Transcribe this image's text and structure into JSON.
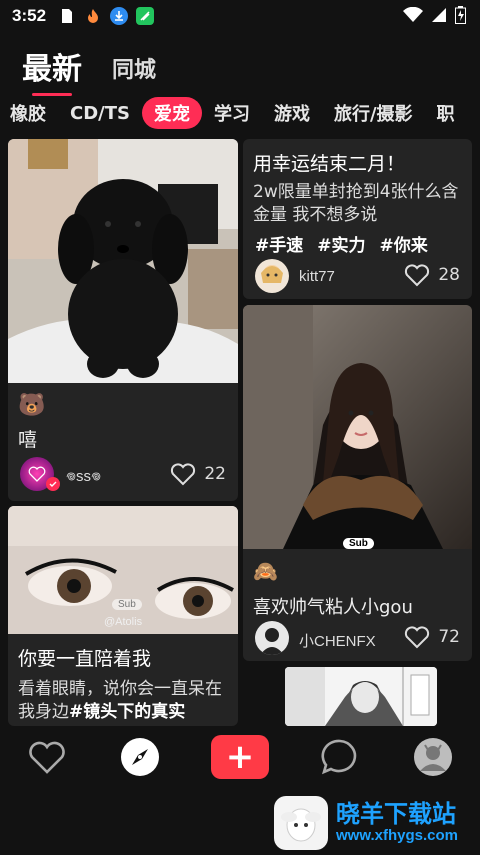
{
  "status_bar": {
    "time": "3:52"
  },
  "top_tabs": {
    "latest": "最新",
    "local": "同城"
  },
  "categories": [
    "橡胶",
    "CD/TS",
    "爱宠",
    "学习",
    "游戏",
    "旅行/摄影",
    "职"
  ],
  "active_category": "爱宠",
  "feed": {
    "card1": {
      "emoji": "🐻",
      "text": "嘻",
      "username": "𖦹ss𖦹",
      "likes": "22"
    },
    "card2": {
      "title": "用幸运结束二月！",
      "body": "2w限量单封抢到4张什么含金量 我不想多说",
      "tags": [
        "#手速",
        "#实力",
        "#你来"
      ],
      "username": "kitt77",
      "likes": "28"
    },
    "card3": {
      "badge": "Sub",
      "emoji": "🙈",
      "text": "喜欢帅气粘人小gou",
      "username": "小CHENFX",
      "likes": "72"
    },
    "card4": {
      "badge": "Sub",
      "overlay": "@Atolis",
      "title": "你要一直陪着我",
      "body_plain": "看着眼睛，说你会一直呆在我身边",
      "body_tag": "#镜头下的真实"
    }
  },
  "bottom_nav": {
    "plus": "+"
  },
  "watermark": {
    "name": "晓羊下载站",
    "url": "www.xfhygs.com"
  },
  "colors": {
    "accent": "#ff2d55",
    "bg": "#121212",
    "card": "#242424",
    "watermark": "#1ea2ff"
  },
  "icons": [
    "heart-icon",
    "compass-icon",
    "plus-icon",
    "chat-bubble-icon",
    "profile-icon"
  ]
}
